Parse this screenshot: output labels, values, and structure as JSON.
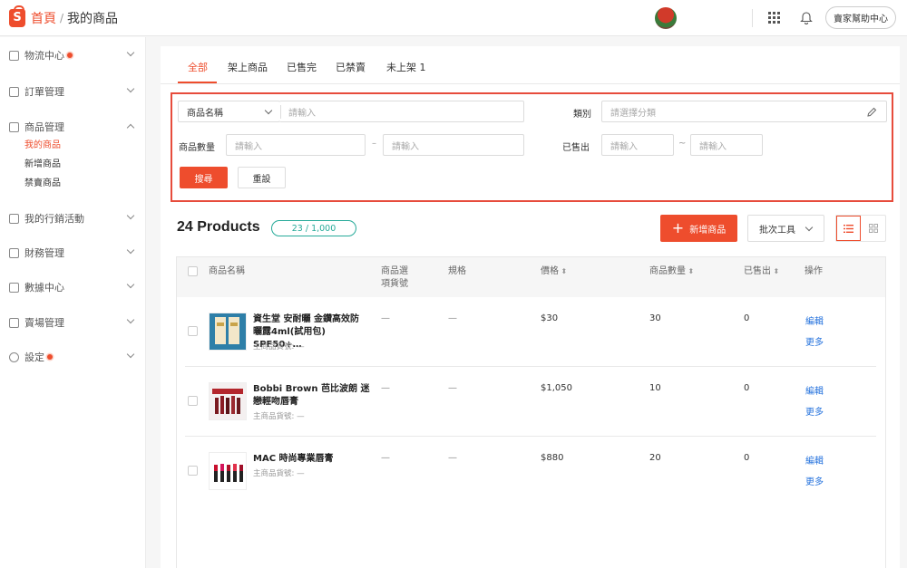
{
  "header": {
    "home": "首頁",
    "separator": "/",
    "current": "我的商品",
    "help_label": "賣家幫助中心"
  },
  "sidebar": {
    "groups": [
      {
        "label": "物流中心",
        "icon": "truck-icon",
        "badge": true
      },
      {
        "label": "訂單管理",
        "icon": "clipboard-icon",
        "badge": false
      },
      {
        "label": "商品管理",
        "icon": "box-icon",
        "badge": false,
        "expanded": true,
        "items": [
          {
            "label": "我的商品",
            "active": true
          },
          {
            "label": "新增商品",
            "active": false
          },
          {
            "label": "禁賣商品",
            "active": false
          }
        ]
      },
      {
        "label": "我的行銷活動",
        "icon": "tag-icon",
        "badge": false
      },
      {
        "label": "財務管理",
        "icon": "wallet-icon",
        "badge": false
      },
      {
        "label": "數據中心",
        "icon": "chart-icon",
        "badge": false
      },
      {
        "label": "賣場管理",
        "icon": "store-icon",
        "badge": false
      },
      {
        "label": "設定",
        "icon": "gear-icon",
        "badge": true
      }
    ]
  },
  "tabs": [
    "全部",
    "架上商品",
    "已售完",
    "已禁賣",
    "未上架 1"
  ],
  "filters": {
    "name_select": "商品名稱",
    "name_placeholder": "請輸入",
    "category_label": "類別",
    "category_placeholder": "請選擇分類",
    "qty_label": "商品數量",
    "qty_min_placeholder": "請輸入",
    "qty_max_placeholder": "請輸入",
    "range_sep": "–",
    "sold_label": "已售出",
    "sold_min_placeholder": "請輸入",
    "sold_max_placeholder": "請輸入",
    "sold_sep": "~",
    "search_label": "搜尋",
    "reset_label": "重設"
  },
  "summary": {
    "title": "24 Products",
    "count": "23 / 1,000",
    "add_label": "新增商品",
    "batch_label": "批次工具"
  },
  "table": {
    "headers": {
      "name": "商品名稱",
      "option_sku_1": "商品選",
      "option_sku_2": "項貨號",
      "spec": "規格",
      "price": "價格",
      "qty": "商品數量",
      "sold": "已售出",
      "action": "操作"
    },
    "rows": [
      {
        "name_line1": "資生堂 安耐曬 金鑽高效防",
        "name_line2": "曬露4ml(試用包) SPF50+…",
        "sku": "主商品貨號: —",
        "option_sku": "—",
        "spec": "—",
        "price": "$30",
        "qty": "30",
        "sold": "0",
        "edit": "編輯",
        "more": "更多"
      },
      {
        "name_line1": "Bobbi Brown 芭比波朗 迷",
        "name_line2": "戀輕吻唇膏",
        "sku": "主商品貨號: —",
        "option_sku": "—",
        "spec": "—",
        "price": "$1,050",
        "qty": "10",
        "sold": "0",
        "edit": "編輯",
        "more": "更多"
      },
      {
        "name_line1": "MAC 時尚專業唇膏",
        "name_line2": "",
        "sku": "主商品貨號: —",
        "option_sku": "—",
        "spec": "—",
        "price": "$880",
        "qty": "20",
        "sold": "0",
        "edit": "編輯",
        "more": "更多"
      }
    ]
  },
  "colors": {
    "accent": "#ee4d2d",
    "teal": "#26aa99",
    "link": "#2673dd"
  }
}
